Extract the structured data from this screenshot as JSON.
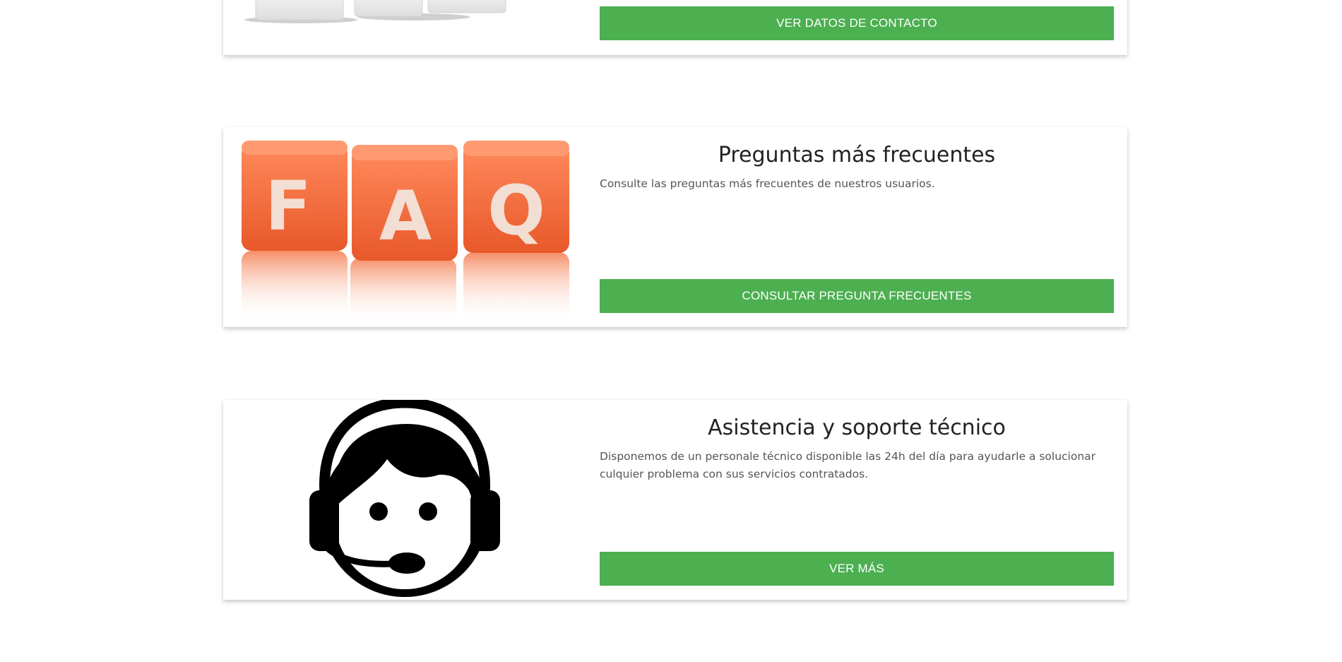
{
  "cards": [
    {
      "button_label": "VER DATOS DE CONTACTO",
      "image_icon": "contact-blocks-image"
    },
    {
      "title": "Preguntas más frecuentes",
      "description": "Consulte las preguntas más frecuentes de nuestros usuarios.",
      "button_label": "CONSULTAR PREGUNTA FRECUENTES",
      "image_icon": "faq-cubes-image",
      "image_letters": [
        "F",
        "A",
        "Q"
      ]
    },
    {
      "title": "Asistencia y soporte técnico",
      "description": "Disponemos de un personale técnico disponible las 24h del día para ayudarle a solucionar culquier problema con sus servicios contratados.",
      "button_label": "VER MÁS",
      "image_icon": "support-headset-agent-icon"
    }
  ],
  "colors": {
    "button": "#4caf50",
    "faq_cube": "#f26a3a"
  }
}
